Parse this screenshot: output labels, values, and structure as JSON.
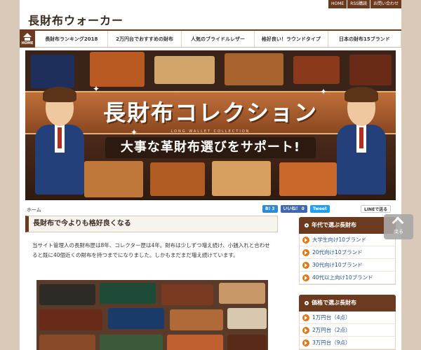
{
  "top_links": [
    "HOME",
    "RSS購読",
    "お問い合わせ"
  ],
  "site_title": "長財布ウォーカー",
  "nav": {
    "home_label": "HOME",
    "items": [
      "長財布ランキング2018",
      "2万円台でおすすめの財布",
      "人気のブライドルレザー",
      "格好良い！ラウンドタイプ",
      "日本の財布15ブランド"
    ]
  },
  "banner": {
    "title": "長財布コレクション",
    "subtitle": "LONG WALLET COLLECTION",
    "tagline": "大事な革財布選びをサポート!"
  },
  "breadcrumb": "ホーム",
  "social": {
    "hatena": "B! 3",
    "like": "いいね！ 0",
    "tweet": "Tweet",
    "line": "LINEで送る"
  },
  "article": {
    "title": "長財布で今よりも格好良くなる",
    "intro": "当サイト管理人の長財布歴は8年、コレクター歴は4年。財布は少しずつ増え続け、小銭入れと合わせると既に40個近くの財布を持つまでになりました。しかもまだまだ増え続けています。"
  },
  "sidebar": {
    "widget1": {
      "title": "年代で選ぶ長財布",
      "items": [
        "大学生向け10ブランド",
        "20代向け10ブランド",
        "30代向け10ブランド",
        "40代以上向け10ブランド"
      ]
    },
    "widget2": {
      "title": "価格で選ぶ長財布",
      "items": [
        "1万円台（4点）",
        "2万円台（2点）",
        "3万円台（9点）"
      ]
    }
  },
  "back_button": "戻る",
  "colors": {
    "brand": "#6b3a1f",
    "link": "#1a4d9c",
    "accent": "#e07818"
  }
}
